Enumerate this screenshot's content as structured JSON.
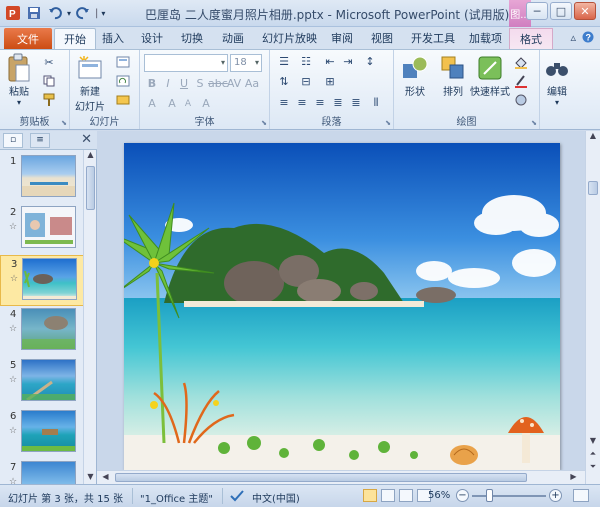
{
  "window": {
    "title": "巴厘岛 二人度蜜月照片相册.pptx - Microsoft PowerPoint (试用版)",
    "context_tab_group": "图...",
    "minimize": "─",
    "maximize": "□",
    "close": "✕"
  },
  "quick_access": {
    "undo_count": "▾",
    "customize": "▾"
  },
  "tabs": {
    "file": "文件",
    "items": [
      "开始",
      "插入",
      "设计",
      "切换",
      "动画",
      "幻灯片放映",
      "审阅",
      "视图",
      "开发工具",
      "加载项",
      "格式"
    ],
    "active_index": 0
  },
  "ribbon": {
    "clipboard": {
      "label": "剪贴板",
      "paste": "粘贴"
    },
    "slides": {
      "label": "幻灯片",
      "new_slide_line1": "新建",
      "new_slide_line2": "幻灯片"
    },
    "font": {
      "label": "字体",
      "font_name": "",
      "font_size": "18"
    },
    "paragraph": {
      "label": "段落"
    },
    "drawing": {
      "label": "绘图",
      "shapes": "形状",
      "arrange": "排列",
      "quick_styles": "快速样式"
    },
    "editing": {
      "label": "编辑"
    }
  },
  "slide_panel": {
    "tab_outline": "≡",
    "close": "✕",
    "slides": [
      {
        "num": "1",
        "star": "",
        "palette": "beach-sunset"
      },
      {
        "num": "2",
        "star": "☆",
        "palette": "couple-photo"
      },
      {
        "num": "3",
        "star": "☆",
        "palette": "beach-rocks"
      },
      {
        "num": "4",
        "star": "☆",
        "palette": "ocean-rocks"
      },
      {
        "num": "5",
        "star": "☆",
        "palette": "pier-sea"
      },
      {
        "num": "6",
        "star": "☆",
        "palette": "villa-sea"
      },
      {
        "num": "7",
        "star": "☆",
        "palette": "pool-sea"
      }
    ],
    "selected_index": 2
  },
  "status_bar": {
    "slide_info": "幻灯片 第 3 张，共 15 张",
    "theme": "\"1_Office 主题\"",
    "language": "中文(中国)",
    "zoom": "56%",
    "zoom_minus": "−",
    "zoom_plus": "+"
  },
  "colors": {
    "file_tab": "#cc4d14",
    "selected_thumb": "#fde9a3",
    "ribbon_bg": "#dde8f5"
  }
}
